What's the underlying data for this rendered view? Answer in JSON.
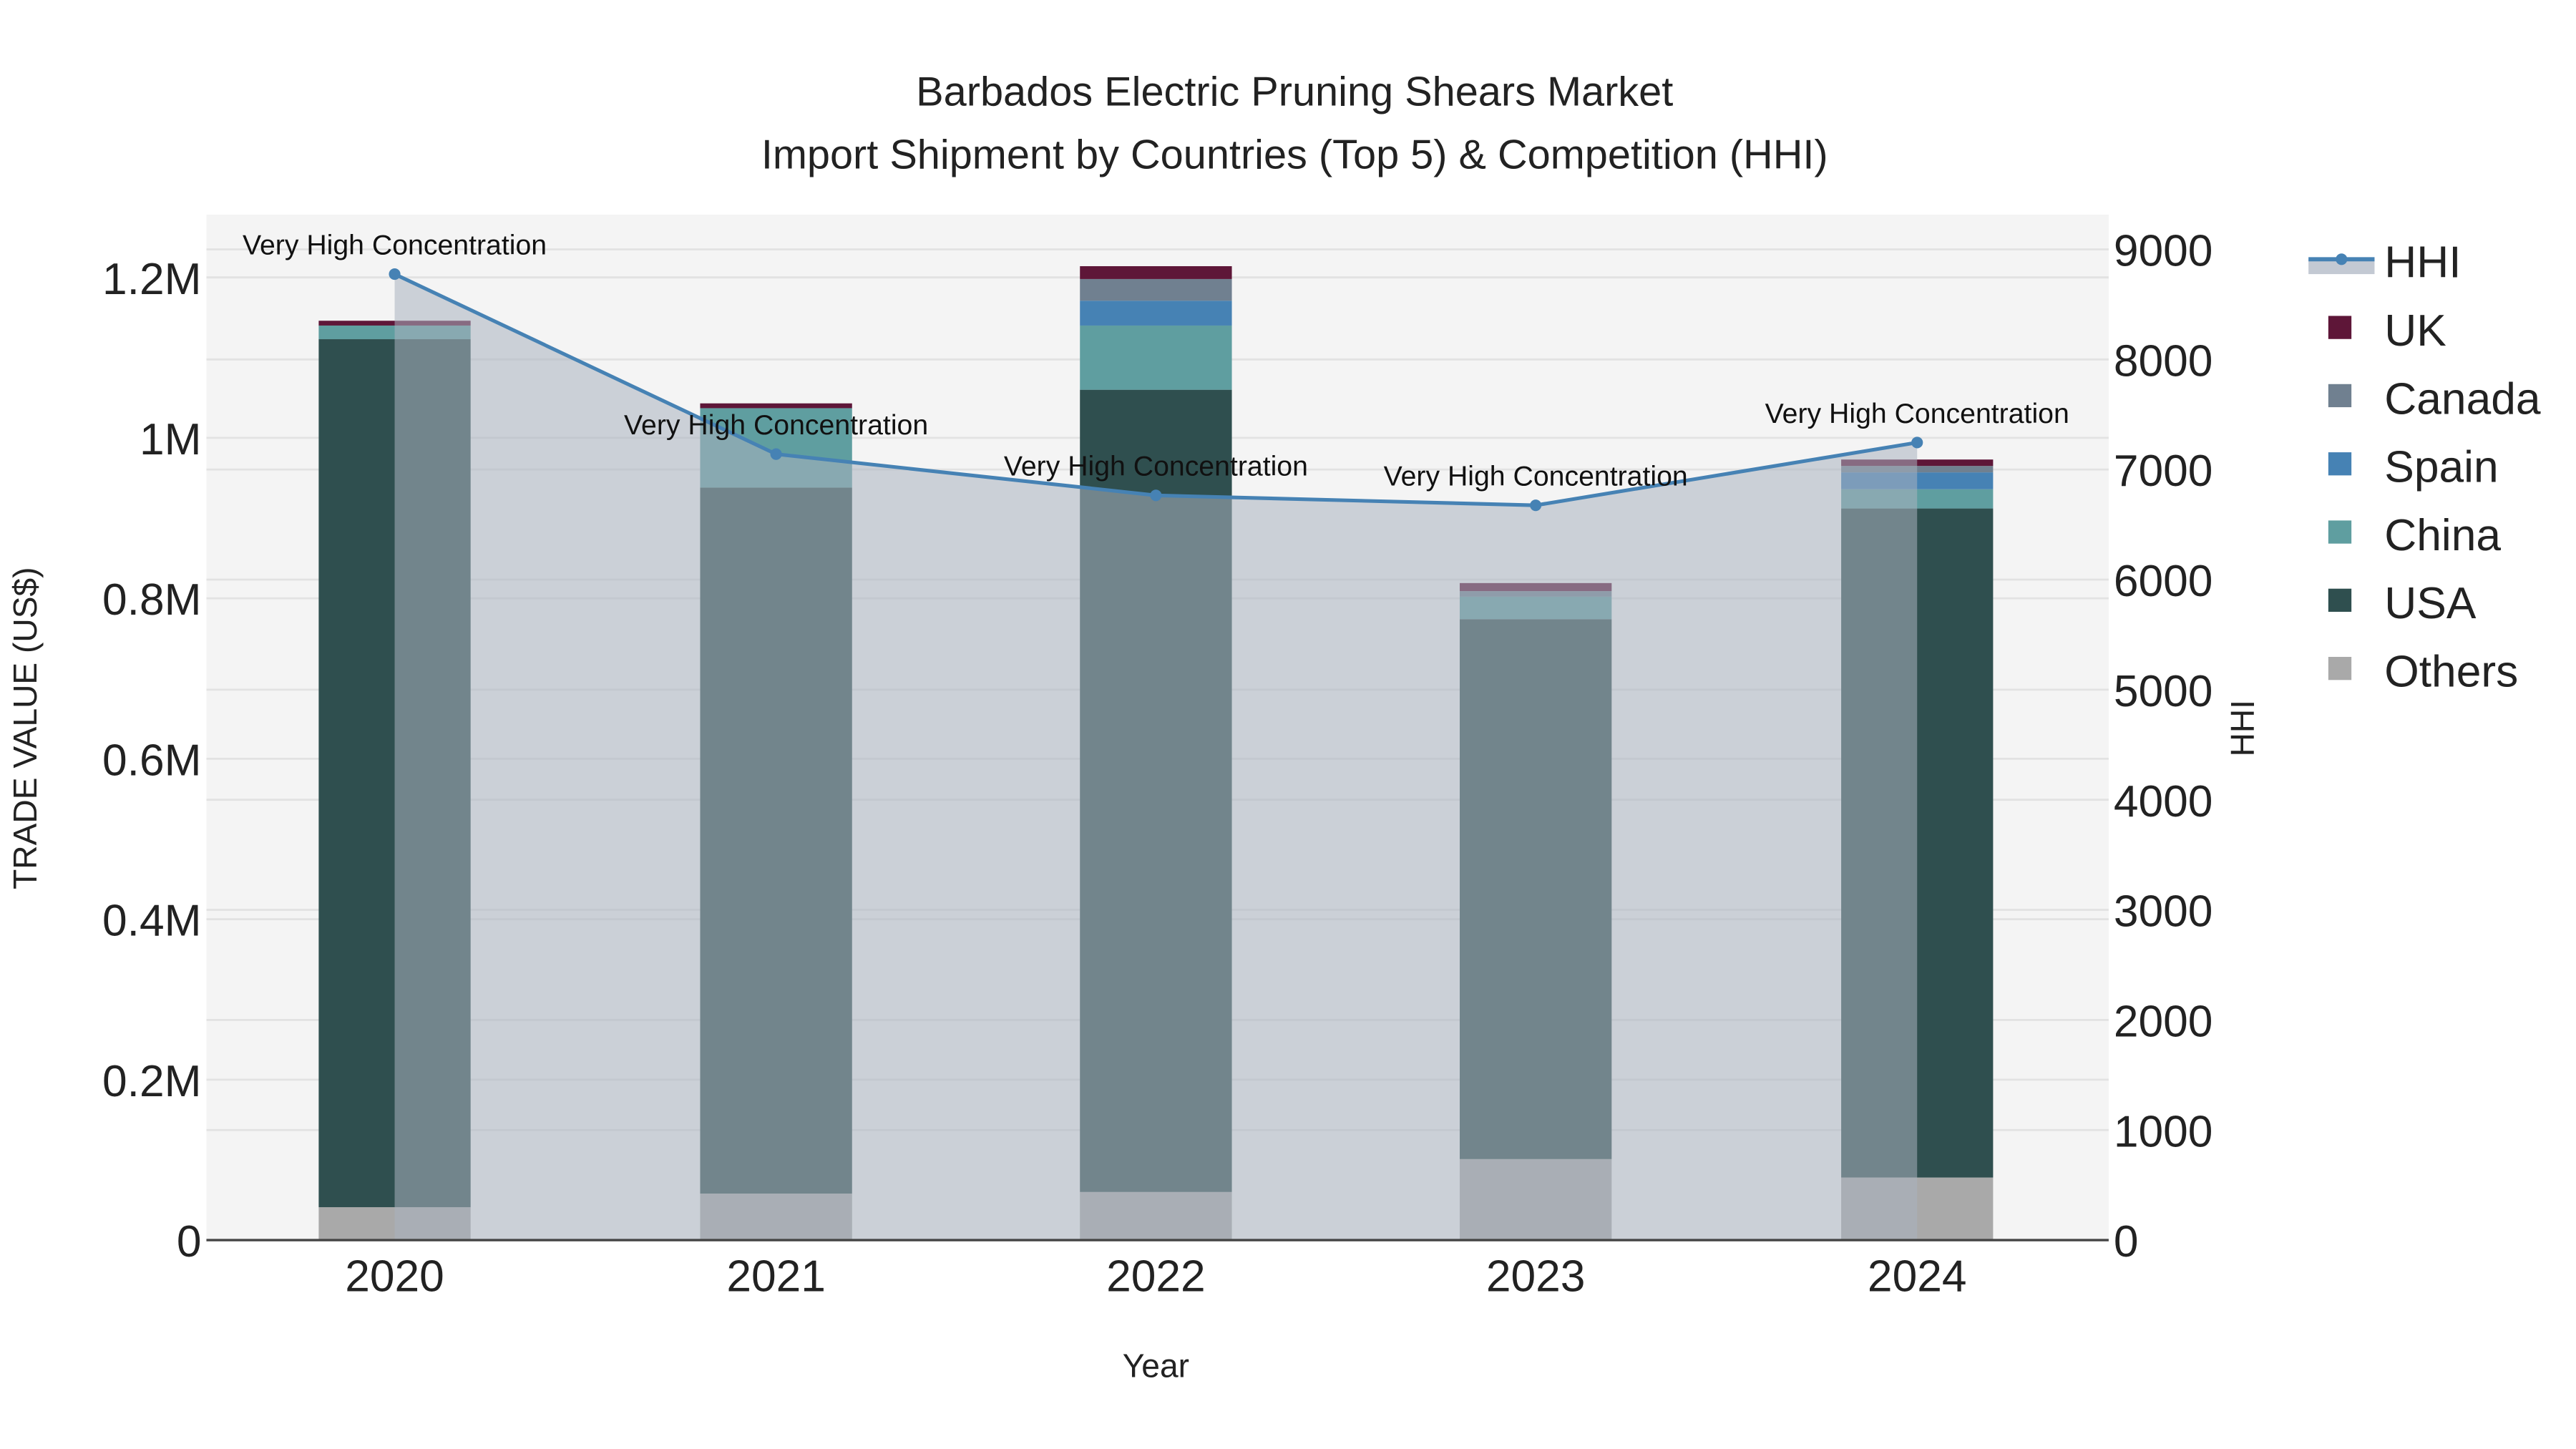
{
  "chart_data": {
    "type": "bar",
    "title": "Barbados Electric Pruning Shears Market",
    "subtitle": "Import Shipment by Countries (Top 5) & Competition (HHI)",
    "xlabel": "Year",
    "ylabel": "TRADE VALUE (US$)",
    "y2label": "HHI",
    "categories": [
      "2020",
      "2021",
      "2022",
      "2023",
      "2024"
    ],
    "ylim": [
      0,
      1280000
    ],
    "yticks": [
      0,
      200000,
      400000,
      600000,
      800000,
      1000000,
      1200000
    ],
    "ytick_labels": [
      "0",
      "0.2M",
      "0.4M",
      "0.6M",
      "0.8M",
      "1M",
      "1.2M"
    ],
    "y2lim": [
      0,
      9300
    ],
    "y2ticks": [
      0,
      1000,
      2000,
      3000,
      4000,
      5000,
      6000,
      7000,
      8000,
      9000
    ],
    "y2tick_labels": [
      "0",
      "1000",
      "2000",
      "3000",
      "4000",
      "5000",
      "6000",
      "7000",
      "8000",
      "9000"
    ],
    "series": [
      {
        "name": "Others",
        "color": "#A9A9A9",
        "values": [
          41000,
          58000,
          60000,
          101000,
          78000
        ]
      },
      {
        "name": "USA",
        "color": "#2F4F4F",
        "values": [
          1082000,
          880000,
          1000000,
          673000,
          834000
        ]
      },
      {
        "name": "China",
        "color": "#5F9EA0",
        "values": [
          17000,
          99000,
          80000,
          28000,
          24000
        ]
      },
      {
        "name": "Spain",
        "color": "#4682B4",
        "values": [
          0,
          0,
          31000,
          0,
          21000
        ]
      },
      {
        "name": "Canada",
        "color": "#708090",
        "values": [
          0,
          0,
          27000,
          7000,
          8000
        ]
      },
      {
        "name": "UK",
        "color": "#5E1638",
        "values": [
          6000,
          6000,
          16000,
          10000,
          8000
        ]
      }
    ],
    "hhi": {
      "name": "HHI",
      "color": "#4682B4",
      "values": [
        8775,
        7140,
        6765,
        6675,
        7245
      ],
      "labels": [
        "Very High Concentration",
        "Very High Concentration",
        "Very High Concentration",
        "Very High Concentration",
        "Very High Concentration"
      ]
    },
    "legend": {
      "position": "right",
      "items": [
        "HHI",
        "UK",
        "Canada",
        "Spain",
        "China",
        "USA",
        "Others"
      ]
    },
    "grid": true
  }
}
